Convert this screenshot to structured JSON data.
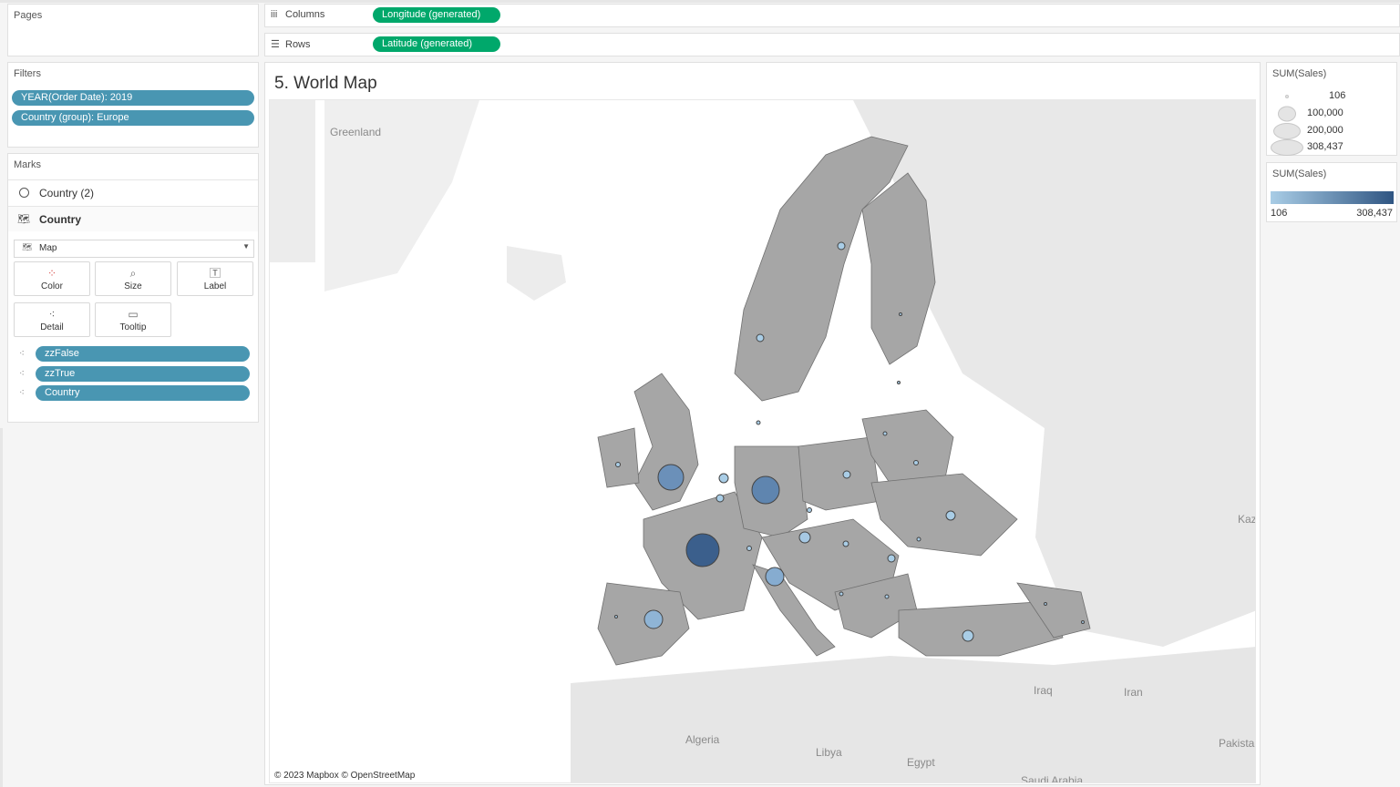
{
  "pages": {
    "title": "Pages"
  },
  "shelves": {
    "columns": {
      "label": "Columns",
      "pill": "Longitude (generated)"
    },
    "rows": {
      "label": "Rows",
      "pill": "Latitude (generated)"
    }
  },
  "filters": {
    "title": "Filters",
    "items": [
      "YEAR(Order Date): 2019",
      "Country (group): Europe"
    ]
  },
  "marks": {
    "title": "Marks",
    "layers": [
      "Country (2)",
      "Country"
    ],
    "mark_type": "Map",
    "buttons": [
      "Color",
      "Size",
      "Label",
      "Detail",
      "Tooltip"
    ],
    "fields": [
      "zzFalse",
      "zzTrue",
      "Country"
    ]
  },
  "sheet": {
    "title": "5. World Map",
    "attribution": "© 2023 Mapbox © OpenStreetMap"
  },
  "map": {
    "labels": [
      "Greenland",
      "Kaz",
      "Iraq",
      "Iran",
      "Algeria",
      "Libya",
      "Egypt",
      "Pakista",
      "Saudi Arabia"
    ],
    "region_fill": "#a6a6a6",
    "land_color": "#e6e6e6",
    "sea_color": "#ffffff"
  },
  "legend_size": {
    "title": "SUM(Sales)",
    "items": [
      "106",
      "100,000",
      "200,000",
      "308,437"
    ]
  },
  "legend_color": {
    "title": "SUM(Sales)",
    "min": "106",
    "max": "308,437",
    "color_low": "#a9cde6",
    "color_high": "#2f5582"
  },
  "colors": {
    "pill_blue": "#4996b2",
    "pill_green": "#00a86b"
  }
}
